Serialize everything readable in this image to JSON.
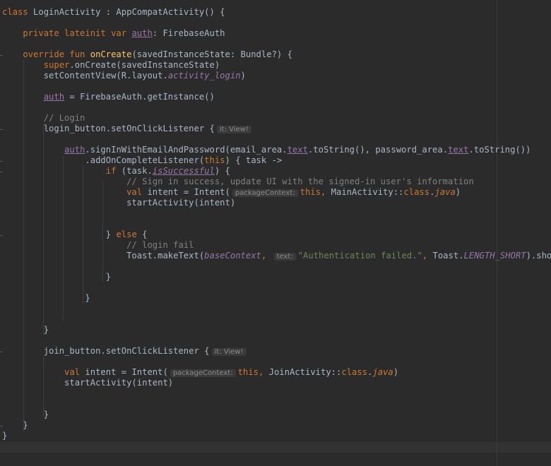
{
  "editor": {
    "language": "kotlin",
    "colors": {
      "background": "#2b2b2b",
      "keyword": "#cc7832",
      "identifier": "#a9b7c6",
      "function": "#ffc66d",
      "property": "#9876aa",
      "string": "#6a8759",
      "comment": "#808080",
      "hint": "#8c8c8c"
    },
    "lines": [
      {
        "tokens": [
          {
            "t": "kw",
            "v": "class "
          },
          {
            "t": "id",
            "v": "LoginActivity : AppCompatActivity() {"
          }
        ]
      },
      {
        "tokens": []
      },
      {
        "tokens": [
          {
            "t": "kw",
            "v": "    private lateinit var "
          },
          {
            "t": "prop-u",
            "v": "auth"
          },
          {
            "t": "id",
            "v": ": FirebaseAuth"
          }
        ]
      },
      {
        "tokens": []
      },
      {
        "tokens": [
          {
            "t": "kw",
            "v": "    override fun "
          },
          {
            "t": "fn",
            "v": "onCreate"
          },
          {
            "t": "id",
            "v": "(savedInstanceState: Bundle?) {"
          }
        ]
      },
      {
        "tokens": [
          {
            "t": "kw",
            "v": "        super"
          },
          {
            "t": "id",
            "v": ".onCreate(savedInstanceState)"
          }
        ]
      },
      {
        "tokens": [
          {
            "t": "id",
            "v": "        setContentView(R.layout."
          },
          {
            "t": "prop-i",
            "v": "activity_login"
          },
          {
            "t": "id",
            "v": ")"
          }
        ]
      },
      {
        "tokens": []
      },
      {
        "tokens": [
          {
            "t": "id",
            "v": "        "
          },
          {
            "t": "prop-u",
            "v": "auth"
          },
          {
            "t": "id",
            "v": " = FirebaseAuth.getInstance()"
          }
        ]
      },
      {
        "tokens": []
      },
      {
        "tokens": [
          {
            "t": "cm",
            "v": "        // Login"
          }
        ]
      },
      {
        "tokens": [
          {
            "t": "id",
            "v": "        login_button.setOnClickListener {"
          },
          {
            "t": "hint",
            "v": "it: View!"
          }
        ]
      },
      {
        "tokens": []
      },
      {
        "tokens": [
          {
            "t": "id",
            "v": "            "
          },
          {
            "t": "prop-u",
            "v": "auth"
          },
          {
            "t": "id",
            "v": ".signInWithEmailAndPassword(email_area."
          },
          {
            "t": "prop-u",
            "v": "text"
          },
          {
            "t": "id",
            "v": ".toString(), password_area."
          },
          {
            "t": "prop-u",
            "v": "text"
          },
          {
            "t": "id",
            "v": ".toString())"
          }
        ]
      },
      {
        "tokens": [
          {
            "t": "id",
            "v": "                .addOnCompleteListener("
          },
          {
            "t": "kw",
            "v": "this"
          },
          {
            "t": "id",
            "v": ") { task ->"
          }
        ]
      },
      {
        "tokens": [
          {
            "t": "kw",
            "v": "                    if "
          },
          {
            "t": "id",
            "v": "(task."
          },
          {
            "t": "prop-iu",
            "v": "isSuccessful"
          },
          {
            "t": "id",
            "v": ") {"
          }
        ]
      },
      {
        "tokens": [
          {
            "t": "cm",
            "v": "                        // Sign in success, update UI with the signed-in user's information"
          }
        ]
      },
      {
        "tokens": [
          {
            "t": "kw",
            "v": "                        val "
          },
          {
            "t": "id",
            "v": "intent = Intent("
          },
          {
            "t": "hint",
            "v": "packageContext:"
          },
          {
            "t": "kw",
            "v": "this"
          },
          {
            "t": "kw",
            "v": ", "
          },
          {
            "t": "id",
            "v": "MainActivity::"
          },
          {
            "t": "kw",
            "v": "class"
          },
          {
            "t": "id",
            "v": "."
          },
          {
            "t": "kw-i",
            "v": "java"
          },
          {
            "t": "id",
            "v": ")"
          }
        ]
      },
      {
        "tokens": [
          {
            "t": "id",
            "v": "                        startActivity(intent)"
          }
        ]
      },
      {
        "tokens": []
      },
      {
        "tokens": []
      },
      {
        "tokens": [
          {
            "t": "id",
            "v": "                    } "
          },
          {
            "t": "kw",
            "v": "else "
          },
          {
            "t": "id",
            "v": "{"
          }
        ]
      },
      {
        "tokens": [
          {
            "t": "cm",
            "v": "                        // login fail"
          }
        ]
      },
      {
        "tokens": [
          {
            "t": "id",
            "v": "                        Toast.makeText("
          },
          {
            "t": "prop-i",
            "v": "baseContext"
          },
          {
            "t": "kw",
            "v": ", "
          },
          {
            "t": "hint",
            "v": "text:"
          },
          {
            "t": "str",
            "v": "\"Authentication failed.\""
          },
          {
            "t": "kw",
            "v": ", "
          },
          {
            "t": "id",
            "v": "Toast."
          },
          {
            "t": "prop-i",
            "v": "LENGTH_SHORT"
          },
          {
            "t": "id",
            "v": ").show()"
          }
        ]
      },
      {
        "tokens": []
      },
      {
        "tokens": [
          {
            "t": "id",
            "v": "                    }"
          }
        ]
      },
      {
        "tokens": []
      },
      {
        "tokens": [
          {
            "t": "id",
            "v": "                }"
          }
        ]
      },
      {
        "tokens": []
      },
      {
        "tokens": []
      },
      {
        "tokens": [
          {
            "t": "id",
            "v": "        }"
          }
        ]
      },
      {
        "tokens": []
      },
      {
        "tokens": [
          {
            "t": "id",
            "v": "        join_button.setOnClickListener {"
          },
          {
            "t": "hint",
            "v": "it: View!"
          }
        ]
      },
      {
        "tokens": []
      },
      {
        "tokens": [
          {
            "t": "kw",
            "v": "            val "
          },
          {
            "t": "id",
            "v": "intent = Intent("
          },
          {
            "t": "hint",
            "v": "packageContext:"
          },
          {
            "t": "kw",
            "v": "this"
          },
          {
            "t": "kw",
            "v": ", "
          },
          {
            "t": "id",
            "v": "JoinActivity::"
          },
          {
            "t": "kw",
            "v": "class"
          },
          {
            "t": "id",
            "v": "."
          },
          {
            "t": "kw-i",
            "v": "java"
          },
          {
            "t": "id",
            "v": ")"
          }
        ]
      },
      {
        "tokens": [
          {
            "t": "id",
            "v": "            startActivity(intent)"
          }
        ]
      },
      {
        "tokens": []
      },
      {
        "tokens": []
      },
      {
        "tokens": [
          {
            "t": "id",
            "v": "        }"
          }
        ]
      },
      {
        "tokens": [
          {
            "t": "id",
            "v": "    }"
          }
        ]
      },
      {
        "tokens": [
          {
            "t": "id",
            "v": "}"
          }
        ]
      }
    ]
  }
}
